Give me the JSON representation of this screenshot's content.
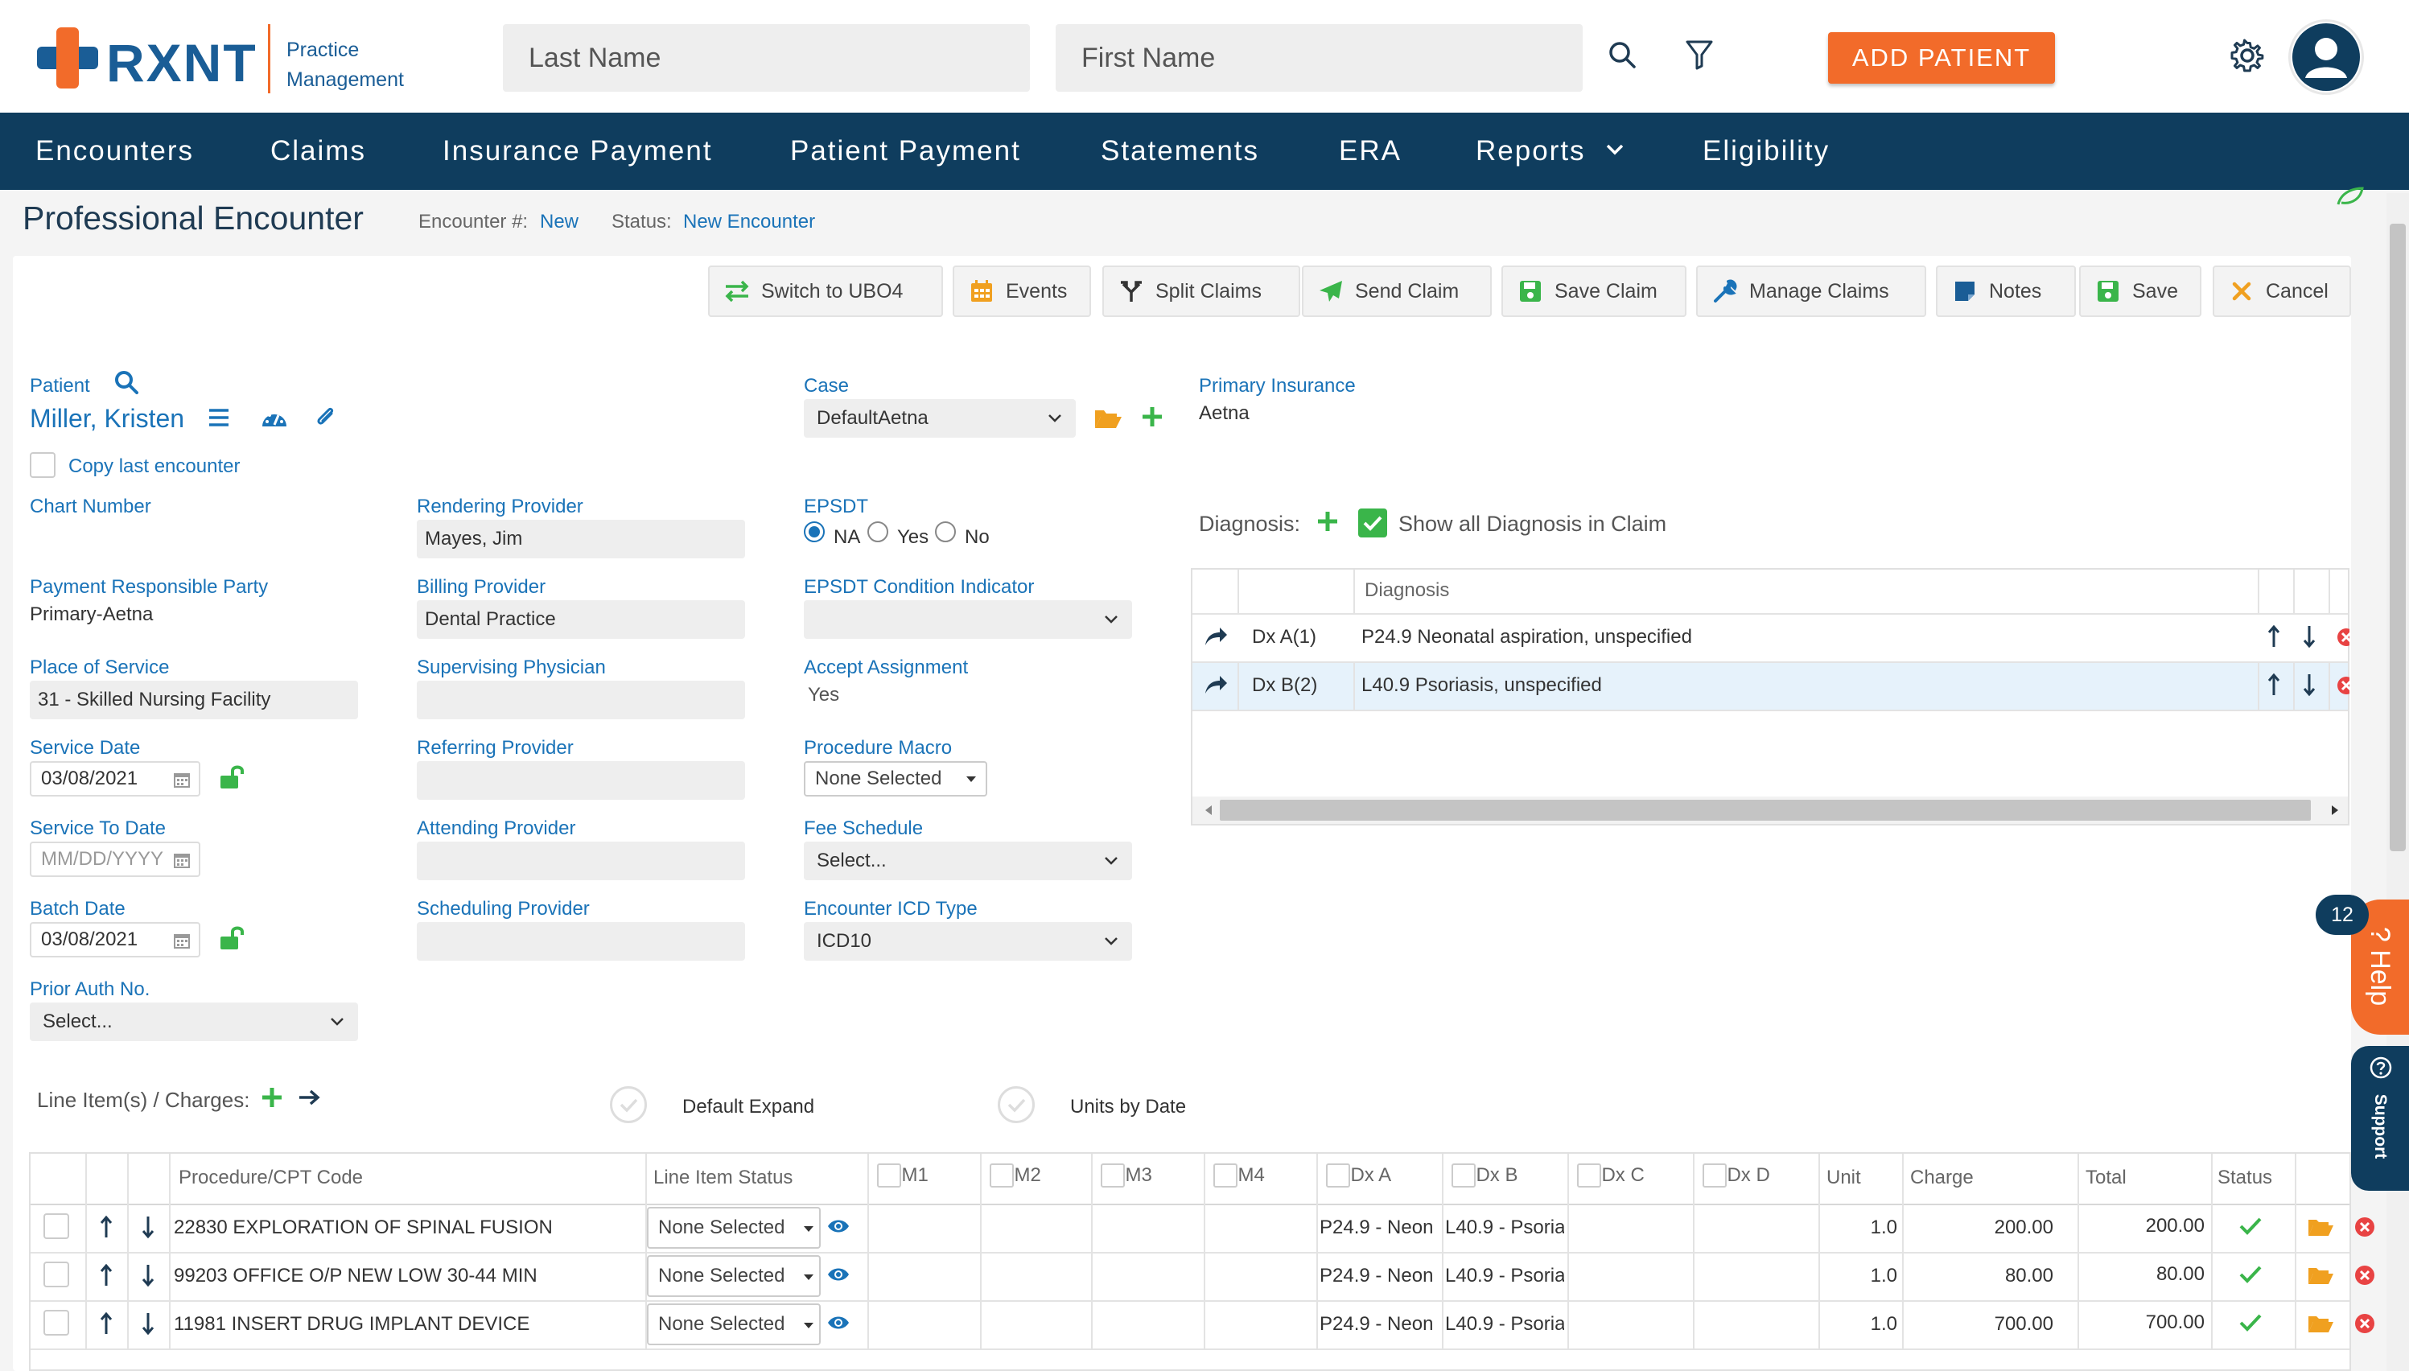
{
  "brand": {
    "name": "RXNT",
    "sub_line1": "Practice",
    "sub_line2": "Management",
    "orange": "#f26b2a",
    "blue": "#1a5d96",
    "green": "#3ab54a"
  },
  "search": {
    "last_name_placeholder": "Last Name",
    "first_name_placeholder": "First Name",
    "search_icon": "search-icon",
    "filter_icon": "filter-icon"
  },
  "header": {
    "add_patient": "ADD PATIENT",
    "settings_icon": "gear-icon",
    "avatar_icon": "user-icon"
  },
  "nav": {
    "items": [
      "Encounters",
      "Claims",
      "Insurance Payment",
      "Patient Payment",
      "Statements",
      "ERA",
      "Reports",
      "Eligibility"
    ],
    "bg": "#0f3d5e"
  },
  "page": {
    "title": "Professional Encounter",
    "encounter_label": "Encounter #:",
    "encounter_value": "New",
    "status_label": "Status:",
    "status_value": "New Encounter"
  },
  "toolbar": {
    "switch": "Switch to UBO4",
    "events": "Events",
    "split": "Split Claims",
    "send": "Send Claim",
    "save_claim": "Save Claim",
    "manage": "Manage Claims",
    "notes": "Notes",
    "save": "Save",
    "cancel": "Cancel"
  },
  "form": {
    "patient_label": "Patient",
    "patient_name": "Miller, Kristen",
    "copy_last": "Copy last encounter",
    "chart_number": "Chart Number",
    "payment_party_label": "Payment Responsible Party",
    "payment_party_value": "Primary-Aetna",
    "place_label": "Place of Service",
    "place_value": "31 - Skilled Nursing Facility",
    "service_date_label": "Service Date",
    "service_date_value": "03/08/2021",
    "service_to_label": "Service To Date",
    "service_to_placeholder": "MM/DD/YYYY",
    "batch_date_label": "Batch Date",
    "batch_date_value": "03/08/2021",
    "prior_auth_label": "Prior Auth No.",
    "prior_auth_value": "Select...",
    "rendering_label": "Rendering Provider",
    "rendering_value": "Mayes, Jim",
    "billing_label": "Billing Provider",
    "billing_value": "Dental Practice",
    "supervising_label": "Supervising Physician",
    "referring_label": "Referring Provider",
    "attending_label": "Attending Provider",
    "scheduling_label": "Scheduling Provider",
    "case_label": "Case",
    "case_value": "DefaultAetna",
    "epsdt_label": "EPSDT",
    "epsdt_options": [
      "NA",
      "Yes",
      "No"
    ],
    "epsdt_selected": "NA",
    "epsdt_cond_label": "EPSDT Condition Indicator",
    "accept_label": "Accept Assignment",
    "accept_value": "Yes",
    "macro_label": "Procedure Macro",
    "macro_value": "None Selected",
    "fee_label": "Fee Schedule",
    "fee_value": "Select...",
    "icd_label": "Encounter ICD Type",
    "icd_value": "ICD10",
    "primary_ins_label": "Primary Insurance",
    "primary_ins_value": "Aetna"
  },
  "diagnosis": {
    "label": "Diagnosis:",
    "show_all": "Show all Diagnosis in Claim",
    "column": "Diagnosis",
    "rows": [
      {
        "code": "Dx A(1)",
        "desc": "P24.9 Neonatal aspiration, unspecified"
      },
      {
        "code": "Dx B(2)",
        "desc": "L40.9 Psoriasis, unspecified"
      }
    ]
  },
  "lines": {
    "label": "Line Item(s) / Charges:",
    "default_expand": "Default Expand",
    "units_by_date": "Units by Date",
    "headers": [
      "Procedure/CPT Code",
      "Line Item Status",
      "M1",
      "M2",
      "M3",
      "M4",
      "Dx A",
      "Dx B",
      "Dx C",
      "Dx D",
      "Unit",
      "Charge",
      "Total",
      "Status"
    ],
    "rows": [
      {
        "code": "22830 EXPLORATION OF SPINAL FUSION",
        "status": "None Selected",
        "dxa": "P24.9 - Neon",
        "dxb": "L40.9 - Psoria",
        "unit": "1.0",
        "charge": "200.00",
        "total": "200.00"
      },
      {
        "code": "99203 OFFICE O/P NEW LOW 30-44 MIN",
        "status": "None Selected",
        "dxa": "P24.9 - Neon",
        "dxb": "L40.9 - Psoria",
        "unit": "1.0",
        "charge": "80.00",
        "total": "80.00"
      },
      {
        "code": "11981 INSERT DRUG IMPLANT DEVICE",
        "status": "None Selected",
        "dxa": "P24.9 - Neon",
        "dxb": "L40.9 - Psoria",
        "unit": "1.0",
        "charge": "700.00",
        "total": "700.00"
      }
    ]
  },
  "help": {
    "badge": "12",
    "help_label": "Help",
    "support_label": "Support"
  }
}
